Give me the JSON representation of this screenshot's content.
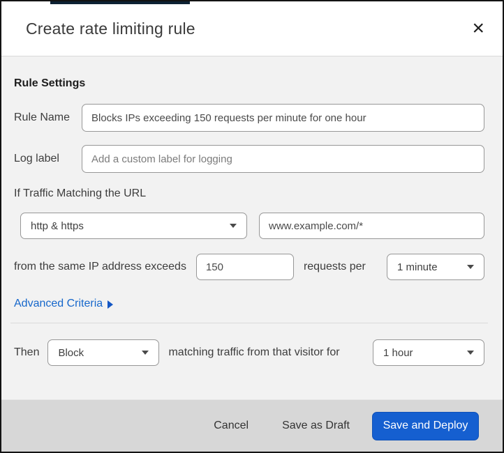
{
  "window": {
    "top_accent_color": "#0d2133"
  },
  "header": {
    "title": "Create rate limiting rule",
    "close_icon": "×"
  },
  "body": {
    "section_heading": "Rule Settings",
    "rule_name": {
      "label": "Rule Name",
      "value": "Blocks IPs exceeding 150 requests per minute for one hour"
    },
    "log_label": {
      "label": "Log label",
      "placeholder": "Add a custom label for logging"
    },
    "traffic_match": {
      "heading": "If Traffic Matching the URL",
      "scheme_select": {
        "value": "http & https",
        "icon": "chevron-down"
      },
      "url_input": {
        "value": "www.example.com/*"
      }
    },
    "threshold": {
      "prefix": "from the same IP address exceeds",
      "requests_value": "150",
      "middle": "requests per",
      "period_select": {
        "value": "1 minute",
        "icon": "chevron-down"
      }
    },
    "advanced_criteria": {
      "label": "Advanced Criteria",
      "icon": "expand-right-arrow"
    },
    "action": {
      "prefix": "Then",
      "action_select": {
        "value": "Block",
        "icon": "chevron-down"
      },
      "middle": "matching traffic from that visitor for",
      "duration_select": {
        "value": "1 hour",
        "icon": "chevron-down"
      }
    }
  },
  "footer": {
    "cancel_label": "Cancel",
    "save_draft_label": "Save as Draft",
    "save_deploy_label": "Save and Deploy"
  },
  "colors": {
    "link_blue": "#1667cb",
    "primary_button_blue": "#155fd0",
    "top_accent_navy": "#0d2133",
    "footer_gray": "#d7d7d7",
    "body_gray": "#f2f2f2"
  }
}
